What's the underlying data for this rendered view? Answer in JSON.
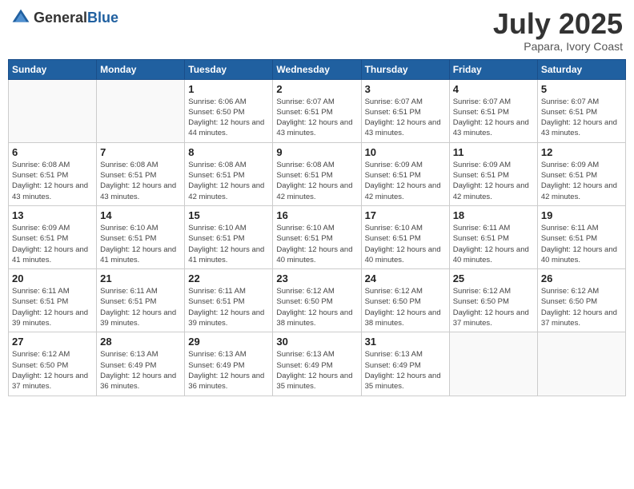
{
  "header": {
    "logo_general": "General",
    "logo_blue": "Blue",
    "title": "July 2025",
    "location": "Papara, Ivory Coast"
  },
  "weekdays": [
    "Sunday",
    "Monday",
    "Tuesday",
    "Wednesday",
    "Thursday",
    "Friday",
    "Saturday"
  ],
  "weeks": [
    [
      {
        "day": "",
        "sunrise": "",
        "sunset": "",
        "daylight": ""
      },
      {
        "day": "",
        "sunrise": "",
        "sunset": "",
        "daylight": ""
      },
      {
        "day": "1",
        "sunrise": "Sunrise: 6:06 AM",
        "sunset": "Sunset: 6:50 PM",
        "daylight": "Daylight: 12 hours and 44 minutes."
      },
      {
        "day": "2",
        "sunrise": "Sunrise: 6:07 AM",
        "sunset": "Sunset: 6:51 PM",
        "daylight": "Daylight: 12 hours and 43 minutes."
      },
      {
        "day": "3",
        "sunrise": "Sunrise: 6:07 AM",
        "sunset": "Sunset: 6:51 PM",
        "daylight": "Daylight: 12 hours and 43 minutes."
      },
      {
        "day": "4",
        "sunrise": "Sunrise: 6:07 AM",
        "sunset": "Sunset: 6:51 PM",
        "daylight": "Daylight: 12 hours and 43 minutes."
      },
      {
        "day": "5",
        "sunrise": "Sunrise: 6:07 AM",
        "sunset": "Sunset: 6:51 PM",
        "daylight": "Daylight: 12 hours and 43 minutes."
      }
    ],
    [
      {
        "day": "6",
        "sunrise": "Sunrise: 6:08 AM",
        "sunset": "Sunset: 6:51 PM",
        "daylight": "Daylight: 12 hours and 43 minutes."
      },
      {
        "day": "7",
        "sunrise": "Sunrise: 6:08 AM",
        "sunset": "Sunset: 6:51 PM",
        "daylight": "Daylight: 12 hours and 43 minutes."
      },
      {
        "day": "8",
        "sunrise": "Sunrise: 6:08 AM",
        "sunset": "Sunset: 6:51 PM",
        "daylight": "Daylight: 12 hours and 42 minutes."
      },
      {
        "day": "9",
        "sunrise": "Sunrise: 6:08 AM",
        "sunset": "Sunset: 6:51 PM",
        "daylight": "Daylight: 12 hours and 42 minutes."
      },
      {
        "day": "10",
        "sunrise": "Sunrise: 6:09 AM",
        "sunset": "Sunset: 6:51 PM",
        "daylight": "Daylight: 12 hours and 42 minutes."
      },
      {
        "day": "11",
        "sunrise": "Sunrise: 6:09 AM",
        "sunset": "Sunset: 6:51 PM",
        "daylight": "Daylight: 12 hours and 42 minutes."
      },
      {
        "day": "12",
        "sunrise": "Sunrise: 6:09 AM",
        "sunset": "Sunset: 6:51 PM",
        "daylight": "Daylight: 12 hours and 42 minutes."
      }
    ],
    [
      {
        "day": "13",
        "sunrise": "Sunrise: 6:09 AM",
        "sunset": "Sunset: 6:51 PM",
        "daylight": "Daylight: 12 hours and 41 minutes."
      },
      {
        "day": "14",
        "sunrise": "Sunrise: 6:10 AM",
        "sunset": "Sunset: 6:51 PM",
        "daylight": "Daylight: 12 hours and 41 minutes."
      },
      {
        "day": "15",
        "sunrise": "Sunrise: 6:10 AM",
        "sunset": "Sunset: 6:51 PM",
        "daylight": "Daylight: 12 hours and 41 minutes."
      },
      {
        "day": "16",
        "sunrise": "Sunrise: 6:10 AM",
        "sunset": "Sunset: 6:51 PM",
        "daylight": "Daylight: 12 hours and 40 minutes."
      },
      {
        "day": "17",
        "sunrise": "Sunrise: 6:10 AM",
        "sunset": "Sunset: 6:51 PM",
        "daylight": "Daylight: 12 hours and 40 minutes."
      },
      {
        "day": "18",
        "sunrise": "Sunrise: 6:11 AM",
        "sunset": "Sunset: 6:51 PM",
        "daylight": "Daylight: 12 hours and 40 minutes."
      },
      {
        "day": "19",
        "sunrise": "Sunrise: 6:11 AM",
        "sunset": "Sunset: 6:51 PM",
        "daylight": "Daylight: 12 hours and 40 minutes."
      }
    ],
    [
      {
        "day": "20",
        "sunrise": "Sunrise: 6:11 AM",
        "sunset": "Sunset: 6:51 PM",
        "daylight": "Daylight: 12 hours and 39 minutes."
      },
      {
        "day": "21",
        "sunrise": "Sunrise: 6:11 AM",
        "sunset": "Sunset: 6:51 PM",
        "daylight": "Daylight: 12 hours and 39 minutes."
      },
      {
        "day": "22",
        "sunrise": "Sunrise: 6:11 AM",
        "sunset": "Sunset: 6:51 PM",
        "daylight": "Daylight: 12 hours and 39 minutes."
      },
      {
        "day": "23",
        "sunrise": "Sunrise: 6:12 AM",
        "sunset": "Sunset: 6:50 PM",
        "daylight": "Daylight: 12 hours and 38 minutes."
      },
      {
        "day": "24",
        "sunrise": "Sunrise: 6:12 AM",
        "sunset": "Sunset: 6:50 PM",
        "daylight": "Daylight: 12 hours and 38 minutes."
      },
      {
        "day": "25",
        "sunrise": "Sunrise: 6:12 AM",
        "sunset": "Sunset: 6:50 PM",
        "daylight": "Daylight: 12 hours and 37 minutes."
      },
      {
        "day": "26",
        "sunrise": "Sunrise: 6:12 AM",
        "sunset": "Sunset: 6:50 PM",
        "daylight": "Daylight: 12 hours and 37 minutes."
      }
    ],
    [
      {
        "day": "27",
        "sunrise": "Sunrise: 6:12 AM",
        "sunset": "Sunset: 6:50 PM",
        "daylight": "Daylight: 12 hours and 37 minutes."
      },
      {
        "day": "28",
        "sunrise": "Sunrise: 6:13 AM",
        "sunset": "Sunset: 6:49 PM",
        "daylight": "Daylight: 12 hours and 36 minutes."
      },
      {
        "day": "29",
        "sunrise": "Sunrise: 6:13 AM",
        "sunset": "Sunset: 6:49 PM",
        "daylight": "Daylight: 12 hours and 36 minutes."
      },
      {
        "day": "30",
        "sunrise": "Sunrise: 6:13 AM",
        "sunset": "Sunset: 6:49 PM",
        "daylight": "Daylight: 12 hours and 35 minutes."
      },
      {
        "day": "31",
        "sunrise": "Sunrise: 6:13 AM",
        "sunset": "Sunset: 6:49 PM",
        "daylight": "Daylight: 12 hours and 35 minutes."
      },
      {
        "day": "",
        "sunrise": "",
        "sunset": "",
        "daylight": ""
      },
      {
        "day": "",
        "sunrise": "",
        "sunset": "",
        "daylight": ""
      }
    ]
  ]
}
